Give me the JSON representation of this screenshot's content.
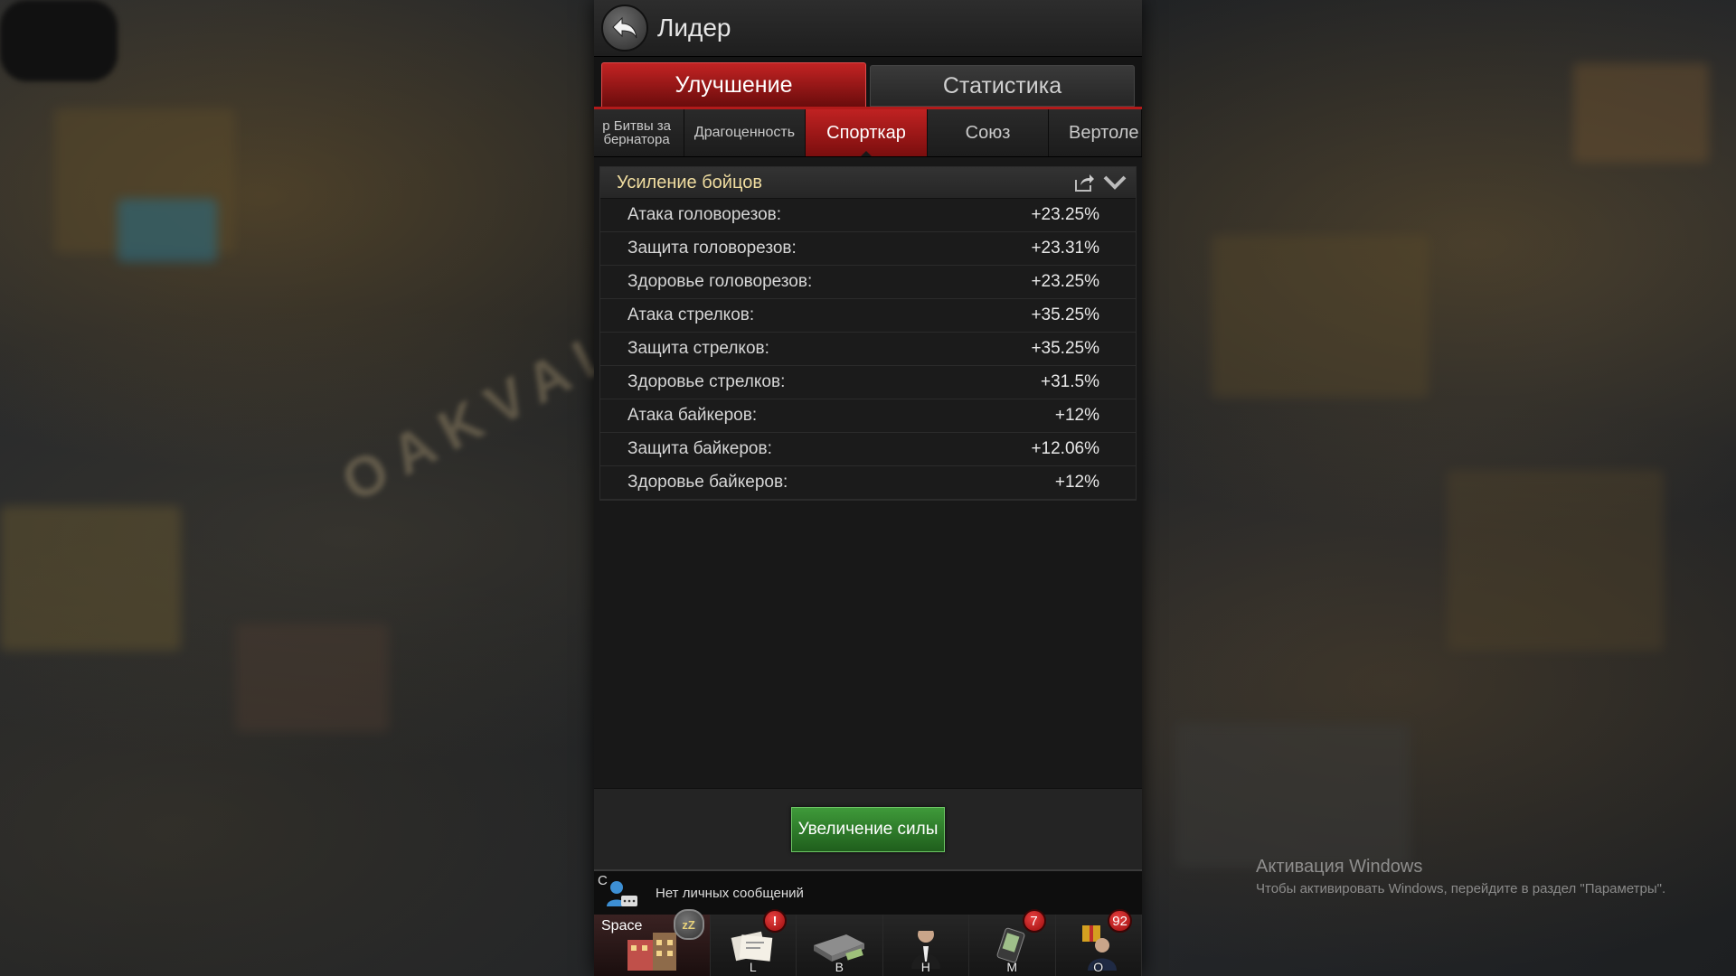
{
  "header": {
    "title": "Лидер"
  },
  "tabs": [
    {
      "label": "Улучшение",
      "active": true
    },
    {
      "label": "Статистика",
      "active": false
    }
  ],
  "subtabs": [
    {
      "label": "р Битвы за\nбернатора",
      "active": false
    },
    {
      "label": "Драгоценность",
      "active": false
    },
    {
      "label": "Спорткар",
      "active": true
    },
    {
      "label": "Союз",
      "active": false
    },
    {
      "label": "Вертоле",
      "active": false
    }
  ],
  "section": {
    "title": "Усиление бойцов",
    "rows": [
      {
        "label": "Атака головорезов:",
        "value": "+23.25%"
      },
      {
        "label": "Защита головорезов:",
        "value": "+23.31%"
      },
      {
        "label": "Здоровье головорезов:",
        "value": "+23.25%"
      },
      {
        "label": "Атака стрелков:",
        "value": "+35.25%"
      },
      {
        "label": "Защита стрелков:",
        "value": "+35.25%"
      },
      {
        "label": "Здоровье стрелков:",
        "value": "+31.5%"
      },
      {
        "label": "Атака байкеров:",
        "value": "+12%"
      },
      {
        "label": "Защита байкеров:",
        "value": "+12.06%"
      },
      {
        "label": "Здоровье байкеров:",
        "value": "+12%"
      }
    ]
  },
  "action": {
    "power_button": "Увеличение силы"
  },
  "chat": {
    "letter": "C",
    "text": "Нет личных сообщений"
  },
  "bottom_bar": {
    "space_label": "Space",
    "sleep_badge": "zZ",
    "items": [
      {
        "key": "L",
        "badge": "!"
      },
      {
        "key": "B",
        "badge": ""
      },
      {
        "key": "H",
        "badge": ""
      },
      {
        "key": "M",
        "badge": "7"
      },
      {
        "key": "O",
        "badge": "92"
      }
    ]
  },
  "windows": {
    "line1": "Активация Windows",
    "line2": "Чтобы активировать Windows, перейдите в раздел \"Параметры\"."
  },
  "background": {
    "watermark": "OAKVALE"
  },
  "colors": {
    "accent_red": "#b21a1a",
    "button_green": "#3f9a3a",
    "section_title": "#f0dda0"
  }
}
